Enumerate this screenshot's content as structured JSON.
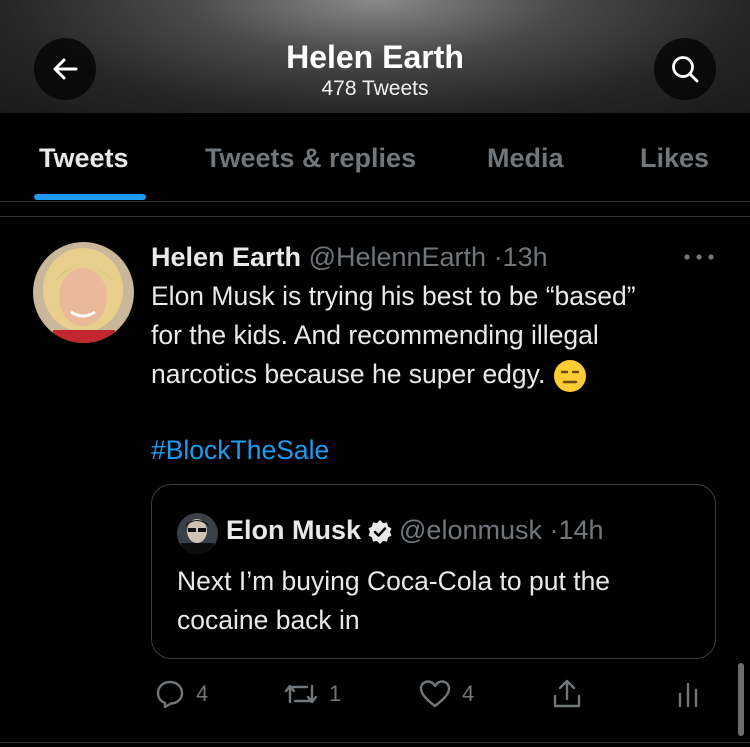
{
  "header": {
    "title": "Helen Earth",
    "subtitle": "478 Tweets",
    "back_icon": "arrow-left-icon",
    "search_icon": "search-icon"
  },
  "tabs": [
    {
      "label": "Tweets",
      "active": true
    },
    {
      "label": "Tweets & replies",
      "active": false
    },
    {
      "label": "Media",
      "active": false
    },
    {
      "label": "Likes",
      "active": false
    }
  ],
  "tweet": {
    "author_name": "Helen Earth",
    "handle": "@HelennEarth",
    "separator": "·",
    "time": "13h",
    "text_lines": [
      "Elon Musk is trying his best to be “based”",
      "for the kids. And recommending illegal",
      "narcotics because he super edgy."
    ],
    "emoji": "expressionless-face",
    "hashtag": "#BlockTheSale",
    "quote": {
      "author_name": "Elon Musk",
      "handle": "@elonmusk",
      "separator": "·",
      "time": "14h",
      "verified": true,
      "text_lines": [
        "Next I’m buying Coca-Cola to put the",
        "cocaine back in"
      ]
    },
    "actions": {
      "replies": "4",
      "retweets": "1",
      "likes": "4"
    }
  },
  "colors": {
    "accent": "#1d9bf0",
    "background": "#000000",
    "muted_text": "#71767b",
    "primary_text": "#e7e9ea"
  }
}
